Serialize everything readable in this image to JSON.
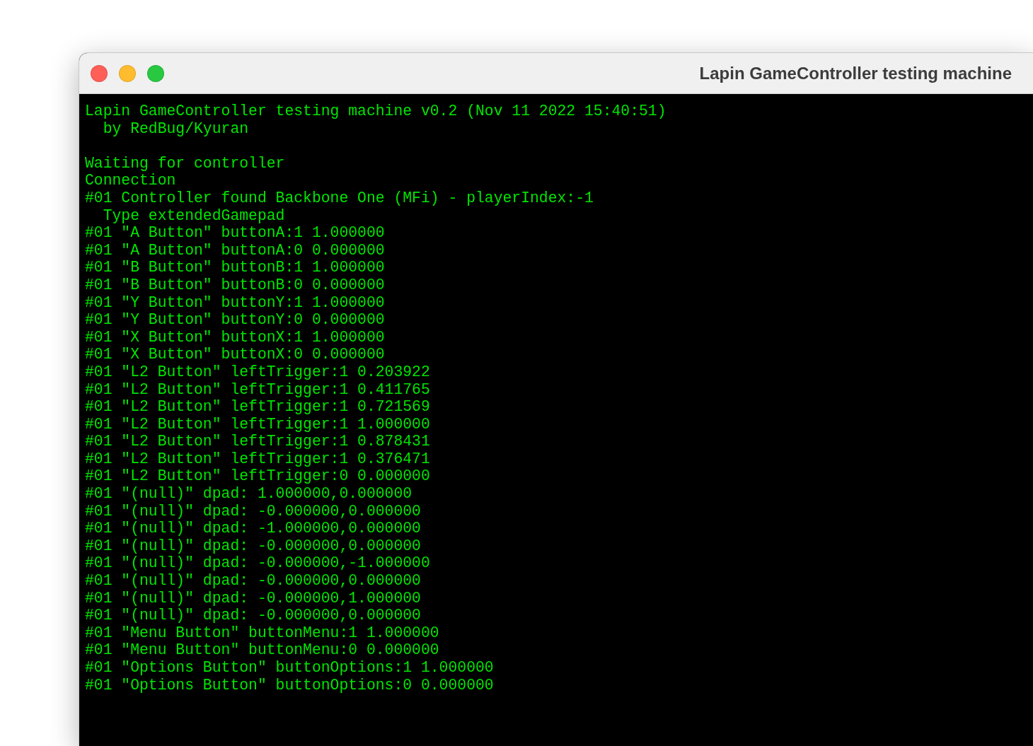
{
  "window": {
    "title": "Lapin GameController testing machine"
  },
  "console": {
    "blocks": [
      [
        "Lapin GameController testing machine v0.2 (Nov 11 2022 15:40:51)",
        "  by RedBug/Kyuran"
      ],
      [
        "Waiting for controller",
        "Connection",
        "#01 Controller found Backbone One (MFi) - playerIndex:-1",
        "  Type extendedGamepad",
        "#01 \"A Button\" buttonA:1 1.000000",
        "#01 \"A Button\" buttonA:0 0.000000",
        "#01 \"B Button\" buttonB:1 1.000000",
        "#01 \"B Button\" buttonB:0 0.000000",
        "#01 \"Y Button\" buttonY:1 1.000000",
        "#01 \"Y Button\" buttonY:0 0.000000",
        "#01 \"X Button\" buttonX:1 1.000000",
        "#01 \"X Button\" buttonX:0 0.000000",
        "#01 \"L2 Button\" leftTrigger:1 0.203922",
        "#01 \"L2 Button\" leftTrigger:1 0.411765",
        "#01 \"L2 Button\" leftTrigger:1 0.721569",
        "#01 \"L2 Button\" leftTrigger:1 1.000000",
        "#01 \"L2 Button\" leftTrigger:1 0.878431",
        "#01 \"L2 Button\" leftTrigger:1 0.376471",
        "#01 \"L2 Button\" leftTrigger:0 0.000000",
        "#01 \"(null)\" dpad: 1.000000,0.000000",
        "#01 \"(null)\" dpad: -0.000000,0.000000",
        "#01 \"(null)\" dpad: -1.000000,0.000000",
        "#01 \"(null)\" dpad: -0.000000,0.000000",
        "#01 \"(null)\" dpad: -0.000000,-1.000000",
        "#01 \"(null)\" dpad: -0.000000,0.000000",
        "#01 \"(null)\" dpad: -0.000000,1.000000",
        "#01 \"(null)\" dpad: -0.000000,0.000000",
        "#01 \"Menu Button\" buttonMenu:1 1.000000",
        "#01 \"Menu Button\" buttonMenu:0 0.000000",
        "#01 \"Options Button\" buttonOptions:1 1.000000",
        "#01 \"Options Button\" buttonOptions:0 0.000000"
      ]
    ]
  }
}
